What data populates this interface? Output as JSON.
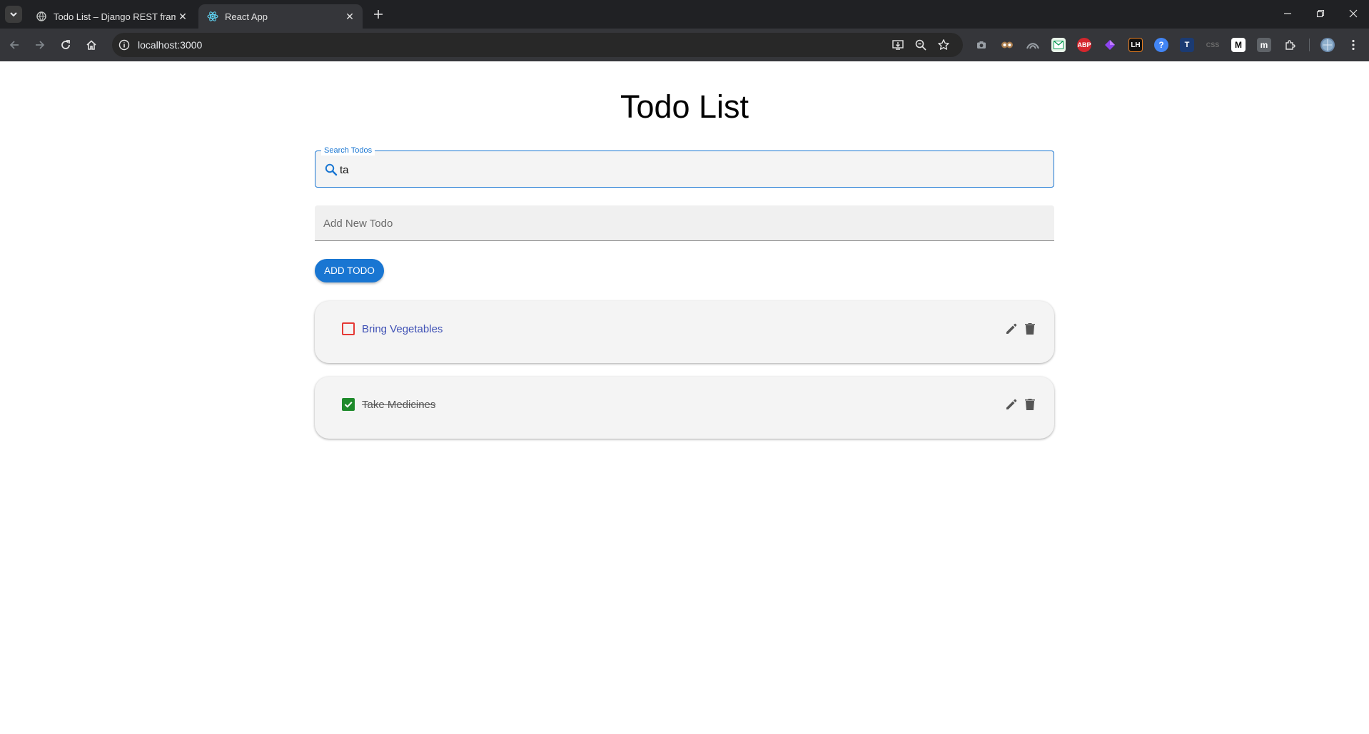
{
  "browser": {
    "tabs": [
      {
        "title": "Todo List – Django REST framew",
        "active": false
      },
      {
        "title": "React App",
        "active": true
      }
    ],
    "url": "localhost:3000",
    "extensions": [
      "camera-icon",
      "owl-icon",
      "bird-icon",
      "green-mail-icon",
      "ABP",
      "purple-gem-icon",
      "LH",
      "question-icon",
      "T",
      "CSS",
      "M",
      "m",
      "puzzle-icon"
    ]
  },
  "page": {
    "title": "Todo List",
    "search": {
      "label": "Search Todos",
      "value": "ta"
    },
    "add": {
      "placeholder": "Add New Todo",
      "button_label": "ADD TODO"
    },
    "todos": [
      {
        "text": "Bring Vegetables",
        "completed": false
      },
      {
        "text": "Take Medicines",
        "completed": true
      }
    ]
  },
  "colors": {
    "primary": "#1976d2",
    "unchecked_border": "#e53935",
    "checked_fill": "#1e8a2b",
    "todo_text": "#3f51b5"
  }
}
